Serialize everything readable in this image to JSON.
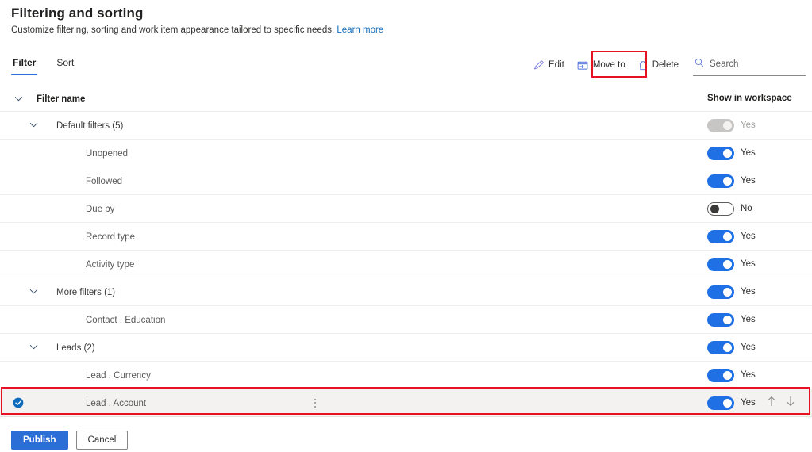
{
  "header": {
    "title": "Filtering and sorting",
    "subtitle": "Customize filtering, sorting and work item appearance tailored to specific needs.",
    "learn_more": "Learn more"
  },
  "tabs": [
    {
      "label": "Filter",
      "active": true
    },
    {
      "label": "Sort",
      "active": false
    }
  ],
  "commandbar": {
    "edit": {
      "label": "Edit",
      "icon": "pencil-icon"
    },
    "move_to": {
      "label": "Move to",
      "icon": "move-to-folder-icon",
      "highlighted": true
    },
    "delete": {
      "label": "Delete",
      "icon": "trash-icon"
    },
    "search": {
      "placeholder": "Search",
      "value": "",
      "icon": "search-icon"
    }
  },
  "table": {
    "columns": {
      "name": "Filter name",
      "workspace": "Show in workspace"
    },
    "rows": [
      {
        "name": "Default filters (5)",
        "level": "group",
        "toggle": "disabled",
        "toggle_label": "Yes",
        "selected": false
      },
      {
        "name": "Unopened",
        "level": "leaf",
        "toggle": "on",
        "toggle_label": "Yes",
        "selected": false
      },
      {
        "name": "Followed",
        "level": "leaf",
        "toggle": "on",
        "toggle_label": "Yes",
        "selected": false
      },
      {
        "name": "Due by",
        "level": "leaf",
        "toggle": "off",
        "toggle_label": "No",
        "selected": false
      },
      {
        "name": "Record type",
        "level": "leaf",
        "toggle": "on",
        "toggle_label": "Yes",
        "selected": false
      },
      {
        "name": "Activity type",
        "level": "leaf",
        "toggle": "on",
        "toggle_label": "Yes",
        "selected": false
      },
      {
        "name": "More filters (1)",
        "level": "group",
        "toggle": "on",
        "toggle_label": "Yes",
        "selected": false
      },
      {
        "name": "Contact . Education",
        "level": "leaf",
        "toggle": "on",
        "toggle_label": "Yes",
        "selected": false
      },
      {
        "name": "Leads (2)",
        "level": "group",
        "toggle": "on",
        "toggle_label": "Yes",
        "selected": false
      },
      {
        "name": "Lead . Currency",
        "level": "leaf",
        "toggle": "on",
        "toggle_label": "Yes",
        "selected": false
      },
      {
        "name": "Lead . Account",
        "level": "leaf",
        "toggle": "on",
        "toggle_label": "Yes",
        "selected": true,
        "icons": [
          "check-circle-icon",
          "more-vertical-icon",
          "move-up-arrow-icon",
          "move-down-arrow-icon"
        ]
      }
    ]
  },
  "footer": {
    "publish": "Publish",
    "cancel": "Cancel"
  },
  "colors": {
    "accent": "#2b6fd6",
    "toggle_on": "#1f6fe5",
    "link": "#0f6cbd",
    "highlight_box": "#e81123",
    "selected_row_bg": "#f3f2f1"
  }
}
